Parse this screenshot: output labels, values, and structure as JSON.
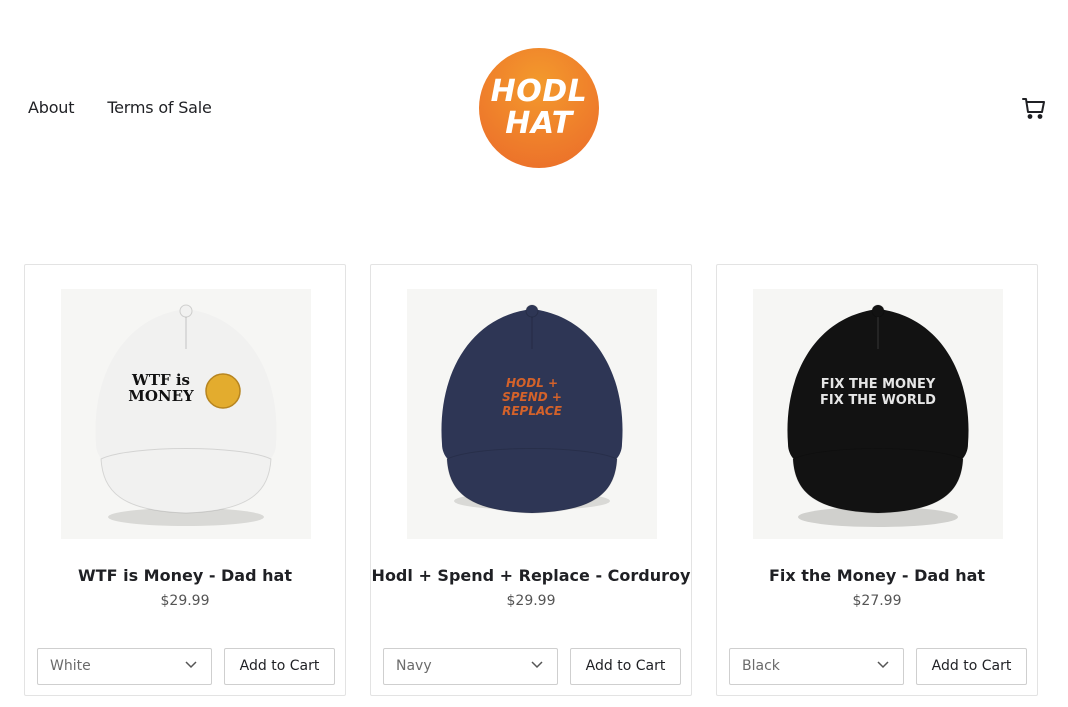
{
  "nav": {
    "about": "About",
    "terms": "Terms of Sale"
  },
  "logo": {
    "line1": "HODL",
    "line2": "HAT"
  },
  "cart_icon": "cart-icon",
  "products": [
    {
      "title": "WTF is Money - Dad hat",
      "price": "$29.99",
      "color": "White",
      "cap_color": "#f1f1f0",
      "print": [
        "WTF is",
        "MONEY"
      ],
      "print_color": "#111111",
      "add": "Add to Cart"
    },
    {
      "title": "Hodl + Spend + Replace - Corduroy",
      "price": "$29.99",
      "color": "Navy",
      "cap_color": "#2e3655",
      "print": [
        "HODL +",
        "SPEND +",
        "REPLACE"
      ],
      "print_color": "#d4622a",
      "add": "Add to Cart"
    },
    {
      "title": "Fix the Money - Dad hat",
      "price": "$27.99",
      "color": "Black",
      "cap_color": "#121212",
      "print": [
        "FIX THE MONEY",
        "FIX THE WORLD"
      ],
      "print_color": "#e6e6e6",
      "add": "Add to Cart"
    }
  ]
}
